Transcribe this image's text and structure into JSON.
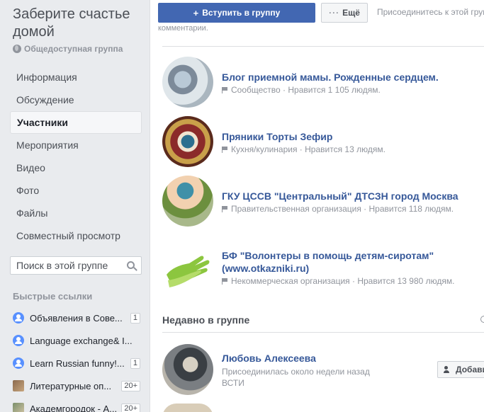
{
  "group": {
    "title": "Заберите счастье домой",
    "type": "Общедоступная группа"
  },
  "nav": {
    "items": [
      {
        "label": "Информация"
      },
      {
        "label": "Обсуждение"
      },
      {
        "label": "Участники",
        "active": true
      },
      {
        "label": "Мероприятия"
      },
      {
        "label": "Видео"
      },
      {
        "label": "Фото"
      },
      {
        "label": "Файлы"
      },
      {
        "label": "Совместный просмотр"
      }
    ]
  },
  "search": {
    "placeholder": "Поиск в этой группе"
  },
  "quick_links": {
    "title": "Быстрые ссылки",
    "items": [
      {
        "label": "Объявления в Сове...",
        "badge": "1"
      },
      {
        "label": "Language exchange& I...",
        "badge": ""
      },
      {
        "label": "Learn Russian funny!...",
        "badge": "1"
      },
      {
        "label": "Литературные оп...",
        "badge": "20+"
      },
      {
        "label": "Академгородок - А...",
        "badge": "20+"
      }
    ]
  },
  "toolbar": {
    "join_label": "Вступить в группу",
    "more_label": "Ещё",
    "hint_line1": "Присоединитесь к этой групп",
    "hint_line2": "комментарии."
  },
  "pages": [
    {
      "name": "Блог приемной мамы. Рожденные сердцем.",
      "category": "Сообщество",
      "likes": "Нравится 1 105 людям."
    },
    {
      "name": "Пряники Торты Зефир",
      "category": "Кухня/кулинария",
      "likes": "Нравится 13 людям."
    },
    {
      "name": "ГКУ ЦССВ \"Центральный\" ДТСЗН город Москва",
      "category": "Правительственная организация",
      "likes": "Нравится 118 людям."
    },
    {
      "name": "БФ \"Волонтеры в помощь детям-сиротам\" (www.otkazniki.ru)",
      "category": "Некоммерческая организация",
      "likes": "Нравится 13 980 людям."
    }
  ],
  "recent": {
    "title": "Недавно в группе",
    "members": [
      {
        "name": "Любовь Алексеева",
        "joined": "Присоединилась около недели назад",
        "place": "ВСТИ",
        "action": "Добавить"
      }
    ]
  },
  "colors": {
    "accent": "#4267b2",
    "link": "#365899",
    "muted": "#90949c",
    "sidebar_bg": "#e9ebee"
  }
}
